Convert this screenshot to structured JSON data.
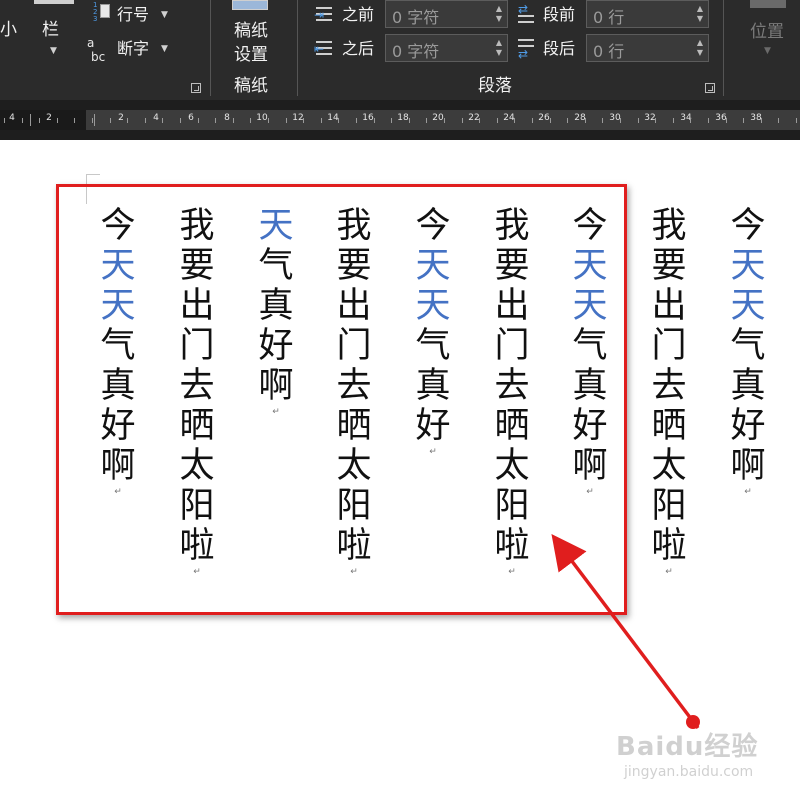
{
  "ribbon": {
    "left_label_1": "小",
    "left_label_2": "栏",
    "line_numbers": "行号",
    "hyphenation": "断字",
    "manuscript_btn": "稿纸设置",
    "manuscript_group": "稿纸",
    "spacing_before_label": "之前",
    "spacing_before_value": "0 字符",
    "spacing_after_label": "之后",
    "spacing_after_value": "0 字符",
    "para_before_label": "段前",
    "para_before_value": "0 行",
    "para_after_label": "段后",
    "para_after_value": "0 行",
    "paragraph_group": "段落",
    "position_btn": "位置"
  },
  "ruler": {
    "labels": [
      "4",
      "2",
      "2",
      "4",
      "6",
      "8",
      "10",
      "12",
      "14",
      "16",
      "18",
      "20",
      "22",
      "24",
      "26",
      "28",
      "30",
      "32",
      "34",
      "36",
      "38"
    ]
  },
  "document": {
    "columns": [
      {
        "text": "今天天气真好啊",
        "blue": [
          1,
          2
        ]
      },
      {
        "text": "我要出门去晒太阳啦",
        "blue": []
      },
      {
        "text": "今天天气真好啊",
        "blue": [
          1,
          2
        ]
      },
      {
        "text": "我要出门去晒太阳啦",
        "blue": []
      },
      {
        "text": "今天天气真好",
        "blue": [
          1,
          2
        ]
      },
      {
        "text": "我要出门去晒太阳啦",
        "blue": []
      },
      {
        "text": "天气真好啊",
        "blue": [
          0
        ]
      },
      {
        "text": "我要出门去晒太阳啦",
        "blue": []
      },
      {
        "text": "今天天气真好啊",
        "blue": [
          1,
          2
        ]
      }
    ],
    "paragraph_mark": "↵"
  },
  "colors": {
    "highlight_text": "#4472c4",
    "annotation_red": "#e01e1e"
  },
  "watermark": {
    "main": "Baidu经验",
    "sub": "jingyan.baidu.com"
  }
}
